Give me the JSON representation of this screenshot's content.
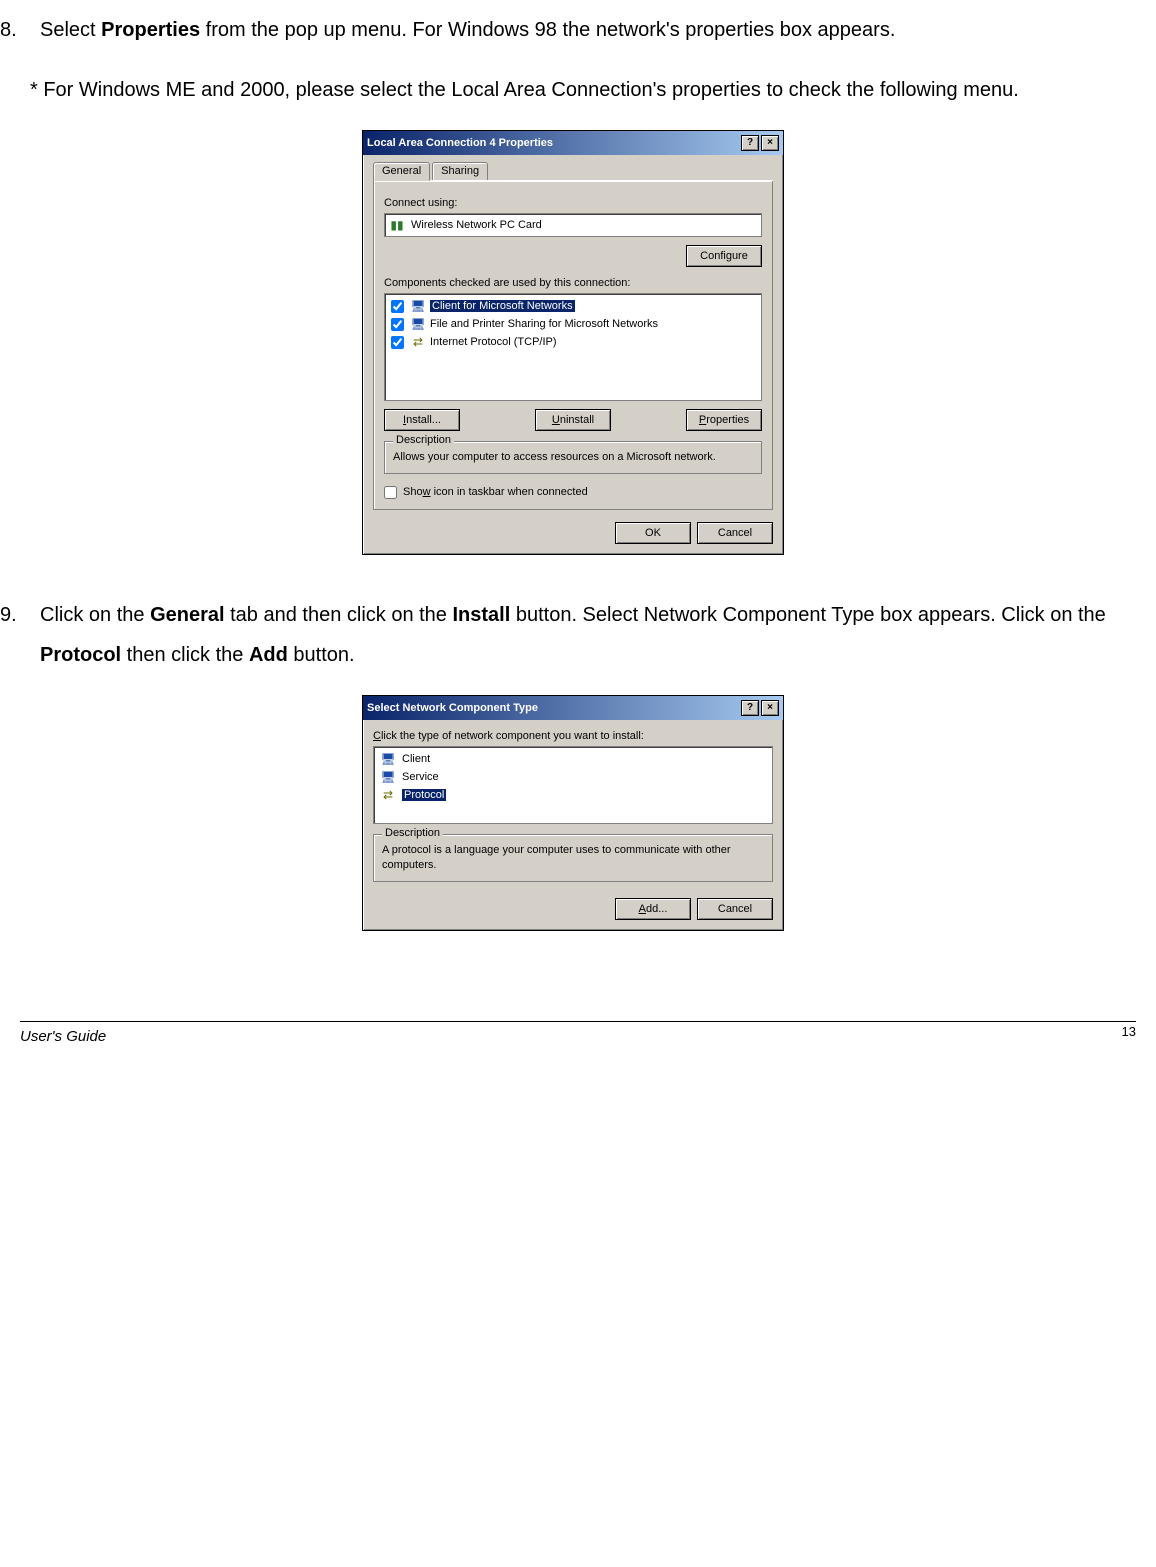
{
  "step8": {
    "num": "8.",
    "pre": "Select ",
    "bold": "Properties",
    "post": " from the pop up menu. For Windows 98 the network's properties box appears."
  },
  "note": "* For Windows ME and 2000, please select the Local Area Connection's properties to check the following menu.",
  "dlg1": {
    "title": "Local Area Connection 4 Properties",
    "tabs": {
      "general": "General",
      "sharing": "Sharing"
    },
    "connect_using_label": "Connect using:",
    "adapter": "Wireless Network PC Card",
    "configure_btn": "Configure",
    "components_label": "Components checked are used by this connection:",
    "items": [
      {
        "label": "Client for Microsoft Networks",
        "checked": true,
        "selected": true,
        "icon": "monitor"
      },
      {
        "label": "File and Printer Sharing for Microsoft Networks",
        "checked": true,
        "selected": false,
        "icon": "monitor"
      },
      {
        "label": "Internet Protocol (TCP/IP)",
        "checked": true,
        "selected": false,
        "icon": "proto"
      }
    ],
    "install_btn": "Install...",
    "uninstall_btn": "Uninstall",
    "properties_btn": "Properties",
    "desc_legend": "Description",
    "desc_text": "Allows your computer to access resources on a Microsoft network.",
    "showicon_label": "Show icon in taskbar when connected",
    "ok": "OK",
    "cancel": "Cancel",
    "install_u": "I",
    "uninstall_u": "U",
    "properties_u": "P",
    "showicon_u": "w"
  },
  "step9": {
    "num": "9.",
    "t1": "Click on the ",
    "b1": "General",
    "t2": " tab and then click on the ",
    "b2": "Install",
    "t3": " button. Select Network Component Type box appears. Click on the ",
    "b3": "Protocol",
    "t4": " then click the ",
    "b4": "Add",
    "t5": " button."
  },
  "dlg2": {
    "title": "Select Network Component Type",
    "prompt_u": "C",
    "prompt": "lick the type of network component you want to install:",
    "items": [
      {
        "label": "Client",
        "selected": false,
        "icon": "monitor"
      },
      {
        "label": "Service",
        "selected": false,
        "icon": "monitor"
      },
      {
        "label": "Protocol",
        "selected": true,
        "icon": "proto"
      }
    ],
    "desc_legend": "Description",
    "desc_text": "A protocol is a language your computer uses to communicate with other computers.",
    "add_u": "A",
    "add_btn": "dd...",
    "cancel": "Cancel"
  },
  "footer": {
    "left": "User's Guide",
    "right": "13"
  }
}
